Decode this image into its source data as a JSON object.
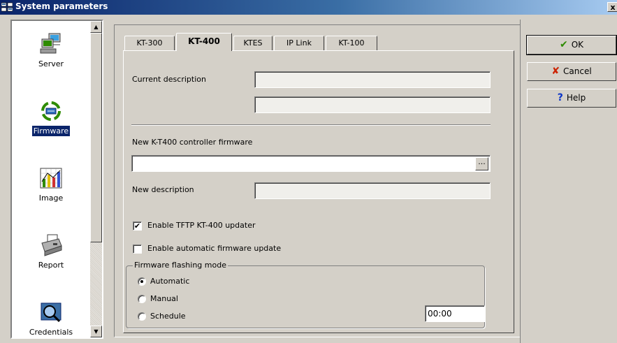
{
  "window": {
    "title": "System parameters",
    "close_glyph": "x"
  },
  "nav": {
    "items": [
      {
        "label": "Server",
        "icon": "server-icon",
        "selected": false
      },
      {
        "label": "Firmware",
        "icon": "firmware-icon",
        "selected": true
      },
      {
        "label": "Image",
        "icon": "image-chart-icon",
        "selected": false
      },
      {
        "label": "Report",
        "icon": "report-printer-icon",
        "selected": false
      },
      {
        "label": "Credentials",
        "icon": "credentials-icon",
        "selected": false
      }
    ],
    "scroll_up": "▲",
    "scroll_down": "▼"
  },
  "tabs": [
    {
      "label": "KT-300",
      "active": false
    },
    {
      "label": "KT-400",
      "active": true
    },
    {
      "label": "KTES",
      "active": false
    },
    {
      "label": "IP Link",
      "active": false
    },
    {
      "label": "KT-100",
      "active": false
    }
  ],
  "form": {
    "current_description_label": "Current description",
    "current_description_value_1": "",
    "current_description_value_2": "",
    "new_firmware_label": "New K-T400 controller firmware",
    "new_firmware_value": "",
    "browse_label": "...",
    "new_description_label": "New description",
    "new_description_value": "",
    "enable_tftp_label": "Enable TFTP KT-400 updater",
    "enable_tftp_checked": true,
    "enable_auto_label": "Enable automatic firmware update",
    "enable_auto_checked": false,
    "flash_mode_title": "Firmware flashing mode",
    "mode_automatic": "Automatic",
    "mode_manual": "Manual",
    "mode_schedule": "Schedule",
    "selected_mode": "Automatic",
    "schedule_time": "00:00",
    "check_glyph": "✔"
  },
  "buttons": {
    "ok": "OK",
    "cancel": "Cancel",
    "help": "Help",
    "ok_glyph": "✔",
    "cancel_glyph": "✘",
    "help_glyph": "?"
  },
  "colors": {
    "ok": "#2e8b00",
    "cancel": "#cc2200",
    "help": "#0a34c8",
    "selection": "#0a246a"
  }
}
